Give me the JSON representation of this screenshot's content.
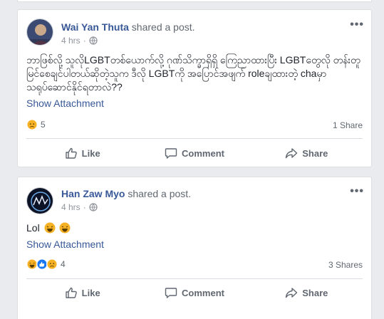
{
  "posts": [
    {
      "author": "Wai Yan Thuta",
      "action": "shared a post.",
      "time": "4 hrs",
      "text": "ဘာဖြစ်လို့ သူလိုLGBTတစ်ယောက်လို့ ဂုဏ်သိက္ခာရှိရှိ ကြေညာထားပြီး LGBTတွေလို တန်းတူမြင်စေချင်ပါတယ်ဆိုတဲ့သူက ဒီလို LGBTကို အပြောင်အဖျက် roleချထားတဲ့ chaမှာ သရုပ်ဆောင်နိုင်ရတာလဲ??",
      "attachment": "Show Attachment",
      "reaction_count": "5",
      "reactions": [
        "sad"
      ],
      "shares": "1 Share"
    },
    {
      "author": "Han Zaw Myo",
      "action": "shared a post.",
      "time": "4 hrs",
      "text": "Lol",
      "text_emojis": [
        "laugh",
        "laugh"
      ],
      "attachment": "Show Attachment",
      "reaction_count": "4",
      "reactions": [
        "haha",
        "like",
        "sad"
      ],
      "shares": "3 Shares"
    }
  ],
  "actions": {
    "like": "Like",
    "comment": "Comment",
    "share": "Share"
  },
  "colors": {
    "link": "#385898",
    "muted": "#606770",
    "like_blue": "#1877f2",
    "emoji_yellow": "#f7b125"
  }
}
